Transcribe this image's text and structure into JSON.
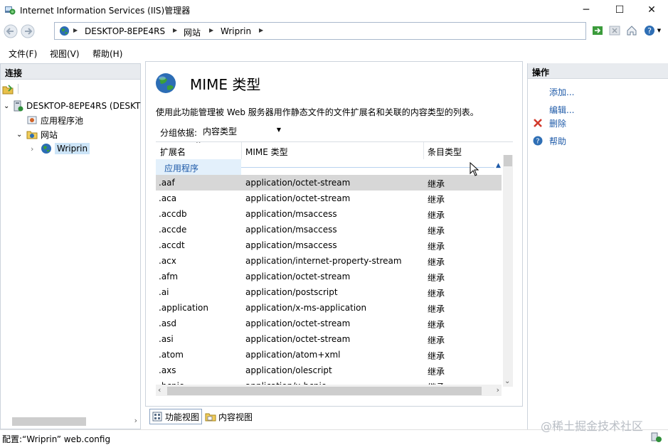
{
  "window": {
    "title": "Internet Information Services (IIS)管理器",
    "controls": {
      "minimize": "─",
      "maximize": "☐",
      "close": "✕"
    }
  },
  "address": {
    "breadcrumbs": [
      "DESKTOP-8EPE4RS",
      "网站",
      "Wriprin"
    ],
    "help_icon_label": "?"
  },
  "menu": [
    "文件(F)",
    "视图(V)",
    "帮助(H)"
  ],
  "connections": {
    "header": "连接",
    "tree": [
      {
        "label": "DESKTOP-8EPE4RS (DESKT",
        "icon": "server-icon",
        "expand": "⌄"
      },
      {
        "label": "应用程序池",
        "icon": "app-pool-icon"
      },
      {
        "label": "网站",
        "icon": "sites-folder-icon",
        "expand": "⌄"
      },
      {
        "label": "Wriprin",
        "icon": "globe-icon",
        "expand": "›",
        "selected": true
      }
    ]
  },
  "feature": {
    "title": "MIME 类型",
    "description": "使用此功能管理被 Web 服务器用作静态文件的文件扩展名和关联的内容类型的列表。",
    "group_by_label": "分组依据:",
    "group_by_value": "内容类型"
  },
  "grid": {
    "columns": [
      "扩展名",
      "MIME 类型",
      "条目类型"
    ],
    "group_label": "应用程序",
    "rows": [
      {
        "ext": ".aaf",
        "mime": "application/octet-stream",
        "entry": "继承",
        "selected": true
      },
      {
        "ext": ".aca",
        "mime": "application/octet-stream",
        "entry": "继承"
      },
      {
        "ext": ".accdb",
        "mime": "application/msaccess",
        "entry": "继承"
      },
      {
        "ext": ".accde",
        "mime": "application/msaccess",
        "entry": "继承"
      },
      {
        "ext": ".accdt",
        "mime": "application/msaccess",
        "entry": "继承"
      },
      {
        "ext": ".acx",
        "mime": "application/internet-property-stream",
        "entry": "继承"
      },
      {
        "ext": ".afm",
        "mime": "application/octet-stream",
        "entry": "继承"
      },
      {
        "ext": ".ai",
        "mime": "application/postscript",
        "entry": "继承"
      },
      {
        "ext": ".application",
        "mime": "application/x-ms-application",
        "entry": "继承"
      },
      {
        "ext": ".asd",
        "mime": "application/octet-stream",
        "entry": "继承"
      },
      {
        "ext": ".asi",
        "mime": "application/octet-stream",
        "entry": "继承"
      },
      {
        "ext": ".atom",
        "mime": "application/atom+xml",
        "entry": "继承"
      },
      {
        "ext": ".axs",
        "mime": "application/olescript",
        "entry": "继承"
      },
      {
        "ext": ".bcpio",
        "mime": "application/x-bcpio",
        "entry": "继承"
      }
    ]
  },
  "view_tabs": [
    "功能视图",
    "内容视图"
  ],
  "actions": {
    "header": "操作",
    "items": [
      {
        "label": "添加...",
        "icon": ""
      },
      {
        "label": "编辑...",
        "icon": ""
      },
      {
        "label": "删除",
        "icon": "delete-icon"
      },
      {
        "label": "帮助",
        "icon": "help-icon"
      }
    ]
  },
  "status": {
    "text": "配置:“Wriprin” web.config"
  },
  "watermark": "@稀土掘金技术社区",
  "colors": {
    "accent": "#1e5aa8",
    "selected_row": "#d7d7d7",
    "group_bg": "#e3f0fb",
    "pane_header": "#e8ebef"
  }
}
